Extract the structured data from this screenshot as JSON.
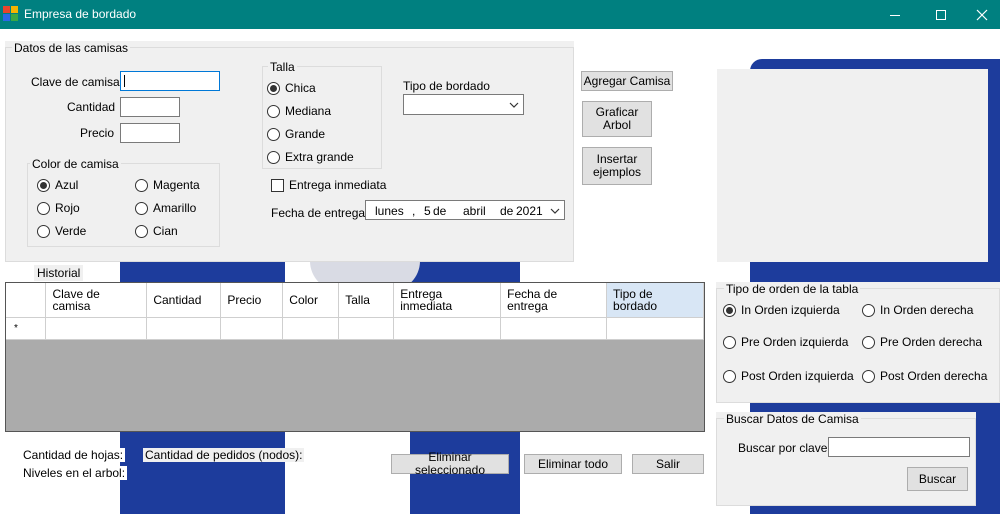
{
  "window": {
    "title": "Empresa de bordado",
    "controls": [
      "minimize-icon",
      "maximize-icon",
      "close-icon"
    ]
  },
  "colors": {
    "titlebar": "#008080",
    "jacket": "#1d3c9c",
    "focus": "#0078d7",
    "panel": "#f0f0f0"
  },
  "datos": {
    "group_title": "Datos de las camisas",
    "clave_label": "Clave de camisa",
    "clave_value": "",
    "cantidad_label": "Cantidad",
    "cantidad_value": "",
    "precio_label": "Precio",
    "precio_value": ""
  },
  "talla": {
    "group_title": "Talla",
    "options": [
      {
        "label": "Chica",
        "checked": true
      },
      {
        "label": "Mediana",
        "checked": false
      },
      {
        "label": "Grande",
        "checked": false
      },
      {
        "label": "Extra grande",
        "checked": false
      }
    ]
  },
  "bordado": {
    "label": "Tipo de bordado",
    "value": ""
  },
  "color": {
    "group_title": "Color de camisa",
    "options": [
      {
        "label": "Azul",
        "checked": true
      },
      {
        "label": "Rojo",
        "checked": false
      },
      {
        "label": "Verde",
        "checked": false
      },
      {
        "label": "Magenta",
        "checked": false
      },
      {
        "label": "Amarillo",
        "checked": false
      },
      {
        "label": "Cian",
        "checked": false
      }
    ]
  },
  "entrega": {
    "checkbox_label": "Entrega inmediata",
    "checked": false,
    "fecha_label": "Fecha de entrega",
    "fecha": {
      "weekday": "lunes",
      "sep": ",",
      "day": "5",
      "de1": "de",
      "month": "abril",
      "de2": "de",
      "year": "2021"
    }
  },
  "buttons": {
    "agregar": "Agregar Camisa",
    "graficar_1": "Graficar",
    "graficar_2": "Arbol",
    "insertar_1": "Insertar",
    "insertar_2": "ejemplos",
    "eliminar_sel": "Eliminar seleccionado",
    "eliminar_todo": "Eliminar todo",
    "salir": "Salir",
    "buscar": "Buscar"
  },
  "historial": {
    "label": "Historial",
    "columns": [
      {
        "l1": "Clave de",
        "l2": "camisa"
      },
      {
        "l1": "Cantidad",
        "l2": ""
      },
      {
        "l1": "Precio",
        "l2": ""
      },
      {
        "l1": "Color",
        "l2": ""
      },
      {
        "l1": "Talla",
        "l2": ""
      },
      {
        "l1": "Entrega",
        "l2": "inmediata"
      },
      {
        "l1": "Fecha de",
        "l2": "entrega"
      },
      {
        "l1": "Tipo de",
        "l2": "bordado"
      }
    ],
    "new_row_marker": "*"
  },
  "footer": {
    "hojas_label": "Cantidad de hojas:",
    "niveles_label": "Niveles en el arbol:",
    "pedidos_label": "Cantidad de pedidos (nodos):"
  },
  "orden": {
    "group_title": "Tipo de orden de la tabla",
    "options": [
      {
        "label": "In Orden izquierda",
        "checked": true
      },
      {
        "label": "In Orden derecha",
        "checked": false
      },
      {
        "label": "Pre Orden izquierda",
        "checked": false
      },
      {
        "label": "Pre Orden derecha",
        "checked": false
      },
      {
        "label": "Post Orden izquierda",
        "checked": false
      },
      {
        "label": "Post Orden derecha",
        "checked": false
      }
    ]
  },
  "buscar": {
    "group_title": "Buscar Datos de Camisa",
    "label": "Buscar por clave",
    "value": ""
  }
}
